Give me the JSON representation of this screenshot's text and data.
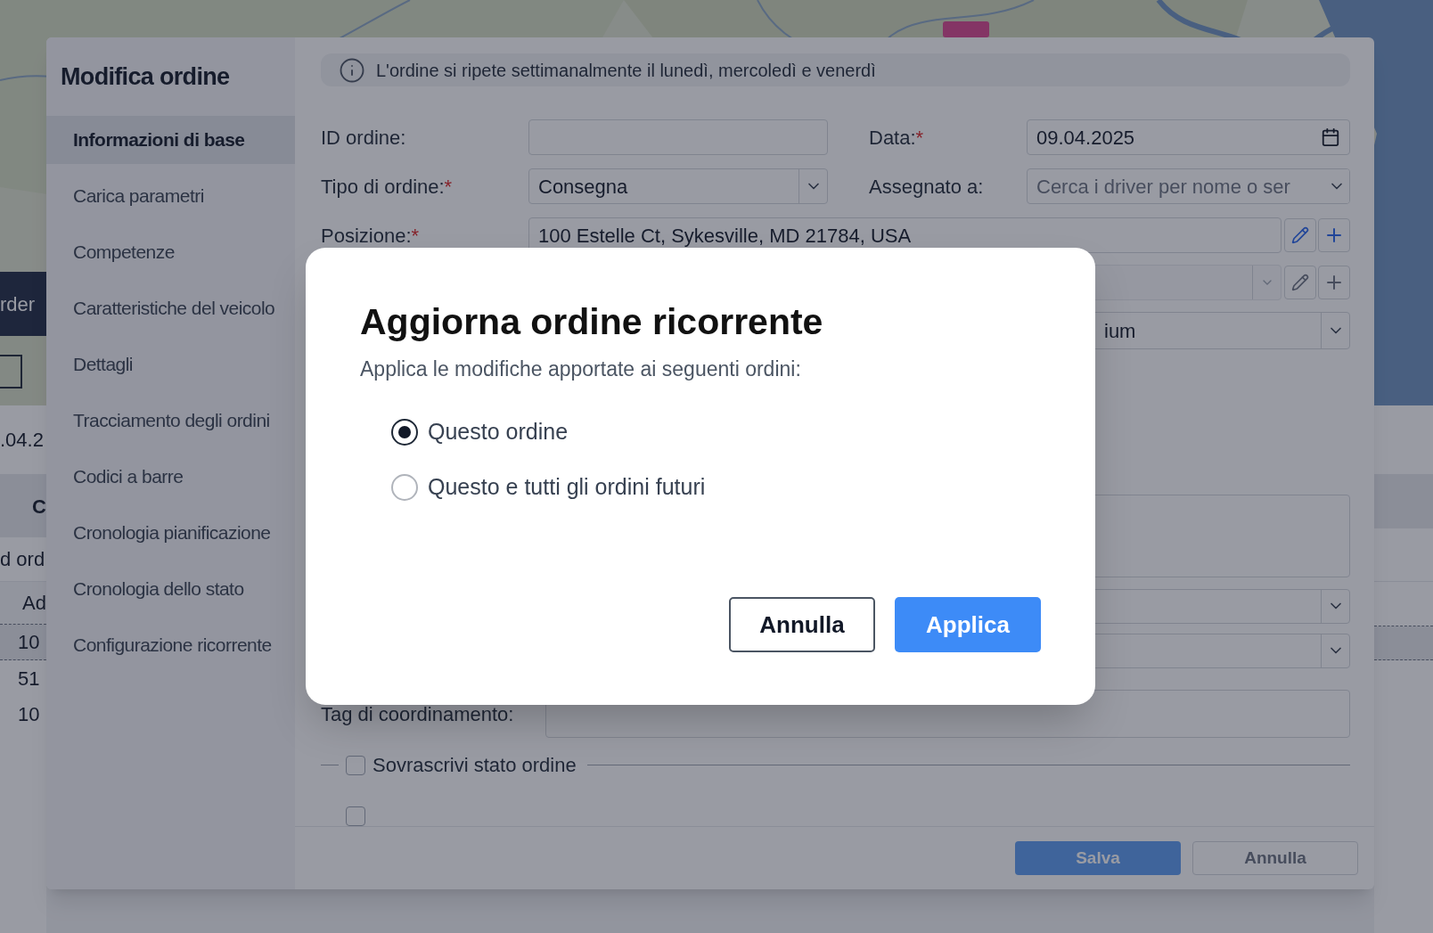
{
  "background": {
    "side_button": "rder",
    "date": ".04.2",
    "column_heading": "C",
    "tab": "d ord",
    "table_header": "Ad",
    "rows": [
      "10",
      "51",
      "10"
    ]
  },
  "edit_order": {
    "title": "Modifica ordine",
    "banner": "L'ordine si ripete settimanalmente il lunedì, mercoledì e venerdì",
    "nav": [
      {
        "label": "Informazioni di base",
        "selected": true
      },
      {
        "label": "Carica parametri",
        "selected": false
      },
      {
        "label": "Competenze",
        "selected": false
      },
      {
        "label": "Caratteristiche del veicolo",
        "selected": false
      },
      {
        "label": "Dettagli",
        "selected": false
      },
      {
        "label": "Tracciamento degli ordini",
        "selected": false
      },
      {
        "label": "Codici a barre",
        "selected": false
      },
      {
        "label": "Cronologia pianificazione",
        "selected": false
      },
      {
        "label": "Cronologia dello stato",
        "selected": false
      },
      {
        "label": "Configurazione ricorrente",
        "selected": false
      }
    ],
    "order_id": {
      "label": "ID ordine:"
    },
    "date": {
      "label": "Data:",
      "required_mark": "*",
      "value": "09.04.2025"
    },
    "order_type": {
      "label": "Tipo di ordine:",
      "required_mark": "*",
      "value": "Consegna"
    },
    "assigned_to": {
      "label": "Assegnato a:",
      "placeholder": "Cerca i driver per nome o ser"
    },
    "position": {
      "label": "Posizione:",
      "required_mark": "*",
      "value": "100 Estelle Ct, Sykesville, MD 21784, USA"
    },
    "priority": {
      "value": "ium"
    },
    "coordination_tag": {
      "label": "Tag di coordinamento:"
    },
    "checkboxes": [
      {
        "label": "Sovrascrivi stato ordine",
        "checked": false
      },
      {
        "checked": false
      }
    ],
    "footer_buttons": [
      {
        "label": "Salva",
        "disabled": true,
        "kind": "primary"
      },
      {
        "label": "Annulla",
        "disabled": false,
        "kind": "secondary"
      }
    ]
  },
  "dialog": {
    "title": "Aggiorna ordine ricorrente",
    "subtitle": "Applica le modifiche apportate ai seguenti ordini:",
    "options": [
      {
        "label": "Questo ordine",
        "selected": true
      },
      {
        "label": "Questo e tutti gli ordini futuri",
        "selected": false
      }
    ],
    "buttons": [
      {
        "label": "Annulla",
        "kind": "secondary"
      },
      {
        "label": "Applica",
        "kind": "primary"
      }
    ]
  }
}
